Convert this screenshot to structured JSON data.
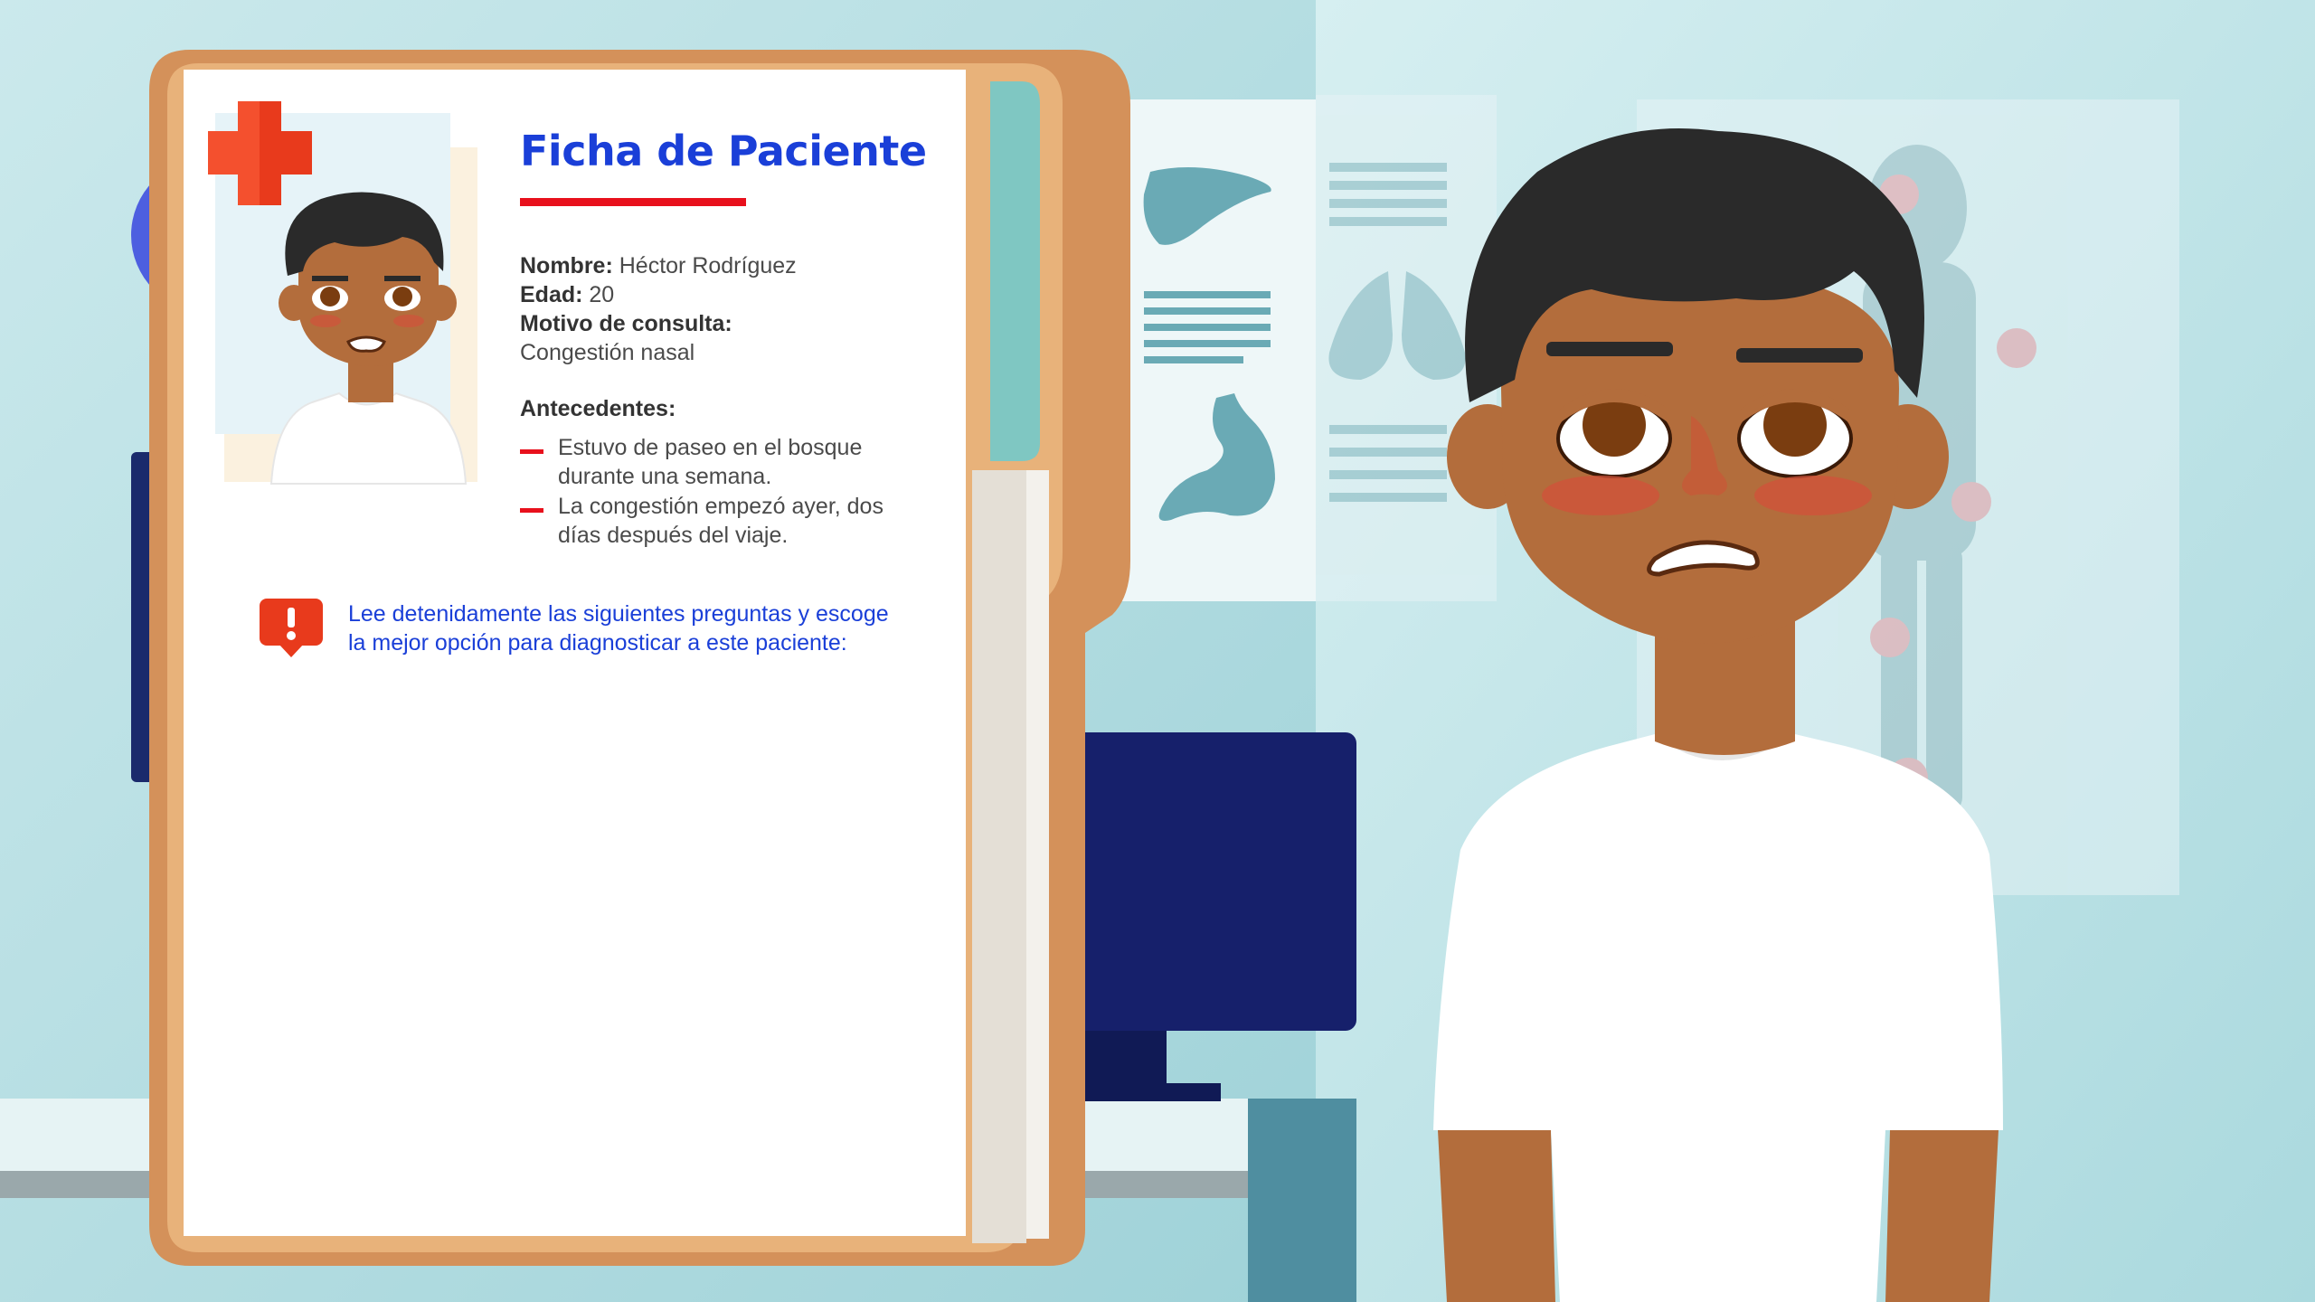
{
  "record": {
    "title": "Ficha de Paciente",
    "fields": [
      {
        "label": "Nombre:",
        "value": " Héctor Rodríguez"
      },
      {
        "label": "Edad:",
        "value": " 20"
      },
      {
        "label": "Motivo de consulta:",
        "value": ""
      }
    ],
    "reason_value": "Congestión nasal",
    "history_title": "Antecedentes:",
    "history": [
      {
        "lines": [
          "Estuvo de paseo en el bosque",
          "durante una semana."
        ]
      },
      {
        "lines": [
          "La congestión empezó ayer, dos",
          "días después del viaje."
        ]
      }
    ],
    "instruction_lines": [
      "Lee detenidamente las siguientes preguntas y escoge",
      "la mejor opción para diagnosticar a este paciente:"
    ]
  },
  "icons": {
    "badge": "medical-cross-icon",
    "alert": "alert-speech-bubble-icon",
    "posters": [
      "liver-icon",
      "lungs-icon",
      "stomach-icon",
      "body-diagram-icon"
    ]
  },
  "colors": {
    "accent_blue": "#1a3fd8",
    "accent_red": "#e8101c",
    "folder": "#e8b27a",
    "background": "#bfe3e6",
    "skin": "#b36d3c"
  }
}
